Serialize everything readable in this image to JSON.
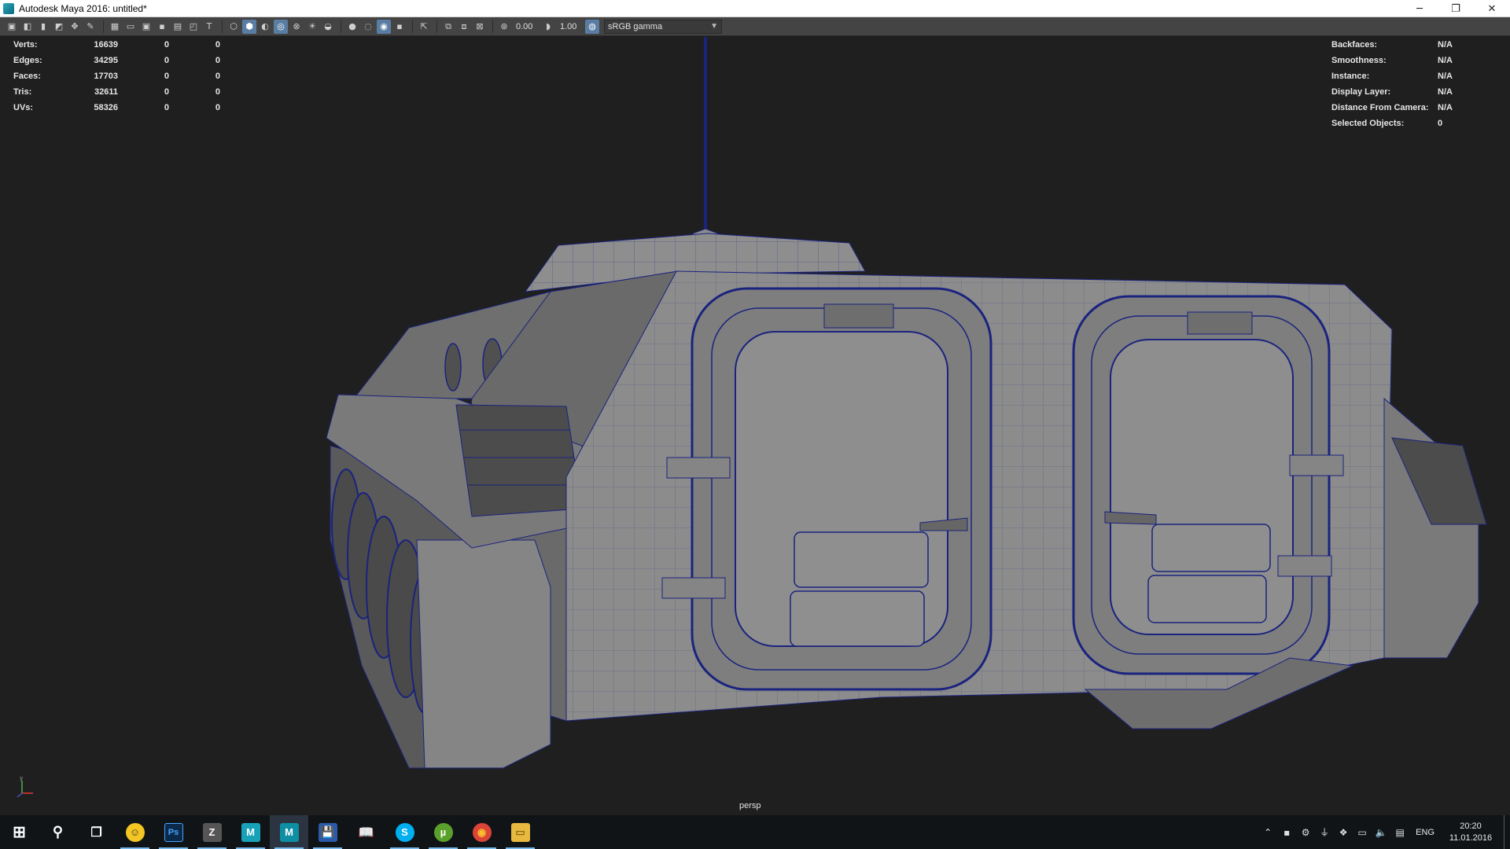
{
  "window": {
    "title": "Autodesk Maya 2016: untitled*",
    "controls": [
      "minimize",
      "restore",
      "close"
    ]
  },
  "toolbar": {
    "exposure_value": "0.00",
    "gamma_value": "1.00",
    "color_space": "sRGB gamma",
    "icons": [
      "camera-select-icon",
      "camera-attributes-icon",
      "bookmark-icon",
      "image-plane-icon",
      "2d-pan-icon",
      "grease-pencil-icon",
      "grid-icon",
      "film-gate-icon",
      "resolution-gate-icon",
      "gate-mask-icon",
      "field-chart-icon",
      "safe-action-icon",
      "safe-title-icon",
      "wireframe-icon",
      "smooth-shade-icon",
      "use-default-material-icon",
      "wireframe-on-shaded-icon",
      "xray-icon",
      "use-all-lights-icon",
      "shadows-icon",
      "screen-space-ao-icon",
      "motion-blur-icon",
      "anti-aliasing-icon",
      "depth-of-field-icon",
      "isolate-select-icon",
      "xray-joints-icon",
      "xray-active-components-icon",
      "exposure-icon",
      "gamma-icon",
      "color-management-icon"
    ]
  },
  "hud_left": {
    "rows": [
      {
        "label": "Verts:",
        "v1": "16639",
        "v2": "0",
        "v3": "0"
      },
      {
        "label": "Edges:",
        "v1": "34295",
        "v2": "0",
        "v3": "0"
      },
      {
        "label": "Faces:",
        "v1": "17703",
        "v2": "0",
        "v3": "0"
      },
      {
        "label": "Tris:",
        "v1": "32611",
        "v2": "0",
        "v3": "0"
      },
      {
        "label": "UVs:",
        "v1": "58326",
        "v2": "0",
        "v3": "0"
      }
    ]
  },
  "hud_right": {
    "rows": [
      {
        "label": "Backfaces:",
        "value": "N/A"
      },
      {
        "label": "Smoothness:",
        "value": "N/A"
      },
      {
        "label": "Instance:",
        "value": "N/A"
      },
      {
        "label": "Display Layer:",
        "value": "N/A"
      },
      {
        "label": "Distance From Camera:",
        "value": "N/A"
      },
      {
        "label": "Selected Objects:",
        "value": "0"
      }
    ]
  },
  "viewport": {
    "camera": "persp",
    "background_color": "#1f1f1f",
    "mesh_color": "#8c8c8c",
    "wire_color": "#1a237e"
  },
  "taskbar": {
    "apps": [
      {
        "name": "start",
        "glyph": "⊞",
        "color": "#ffffff"
      },
      {
        "name": "search",
        "glyph": "⚲",
        "color": "#ffffff"
      },
      {
        "name": "task-view",
        "glyph": "❐",
        "color": "#ffffff"
      },
      {
        "name": "app-emoji",
        "glyph": "☺",
        "color": "#f3c623",
        "open": true
      },
      {
        "name": "photoshop",
        "glyph": "Ps",
        "color": "#0b2a4a",
        "open": true
      },
      {
        "name": "zbrush",
        "glyph": "Z",
        "color": "#555555",
        "open": true
      },
      {
        "name": "maya-blue",
        "glyph": "M",
        "color": "#17a2b8",
        "open": true
      },
      {
        "name": "maya",
        "glyph": "M",
        "color": "#0e8fa3",
        "open": true,
        "active": true
      },
      {
        "name": "save-app",
        "glyph": "💾",
        "color": "#2a5aa8",
        "open": true
      },
      {
        "name": "reader",
        "glyph": "📖",
        "color": "#333333",
        "open": false
      },
      {
        "name": "skype",
        "glyph": "S",
        "color": "#00aff0",
        "open": true
      },
      {
        "name": "utorrent",
        "glyph": "µ",
        "color": "#5aa02c",
        "open": true
      },
      {
        "name": "chrome",
        "glyph": "◉",
        "color": "#db4437",
        "open": true
      },
      {
        "name": "file-explorer",
        "glyph": "▭",
        "color": "#e8b940",
        "open": true
      }
    ],
    "tray": {
      "language": "ENG",
      "time": "20:20",
      "date": "11.01.2016"
    }
  }
}
